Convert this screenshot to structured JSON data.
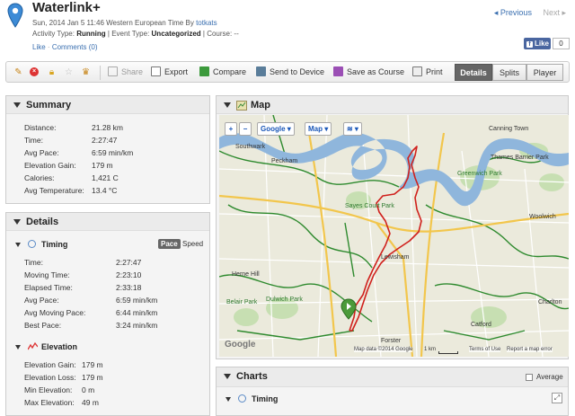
{
  "header": {
    "title": "Waterlink+",
    "date_prefix": "Sun, 2014 Jan 5 11:46 Western European Time By",
    "user": "totkats",
    "activity_type_label": "Activity Type:",
    "activity_type": "Running",
    "event_type_label": "| Event Type:",
    "event_type": "Uncategorized",
    "course_text": "| Course: --",
    "like_link": "Like",
    "comments_link": "Comments (0)",
    "sep": "·",
    "prev": "◂ Previous",
    "next": "Next ▸",
    "fb_like": "Like",
    "fb_count": "0"
  },
  "toolbar": {
    "share": "Share",
    "export": "Export",
    "compare": "Compare",
    "send": "Send to Device",
    "save_course": "Save as Course",
    "print": "Print",
    "tabs": [
      "Details",
      "Splits",
      "Player"
    ]
  },
  "summary": {
    "title": "Summary",
    "rows": [
      {
        "label": "Distance:",
        "value": "21.28 km"
      },
      {
        "label": "Time:",
        "value": "2:27:47"
      },
      {
        "label": "Avg Pace:",
        "value": "6:59 min/km"
      },
      {
        "label": "Elevation Gain:",
        "value": "179 m"
      },
      {
        "label": "Calories:",
        "value": "1,421 C"
      },
      {
        "label": "Avg Temperature:",
        "value": "13.4 °C"
      }
    ]
  },
  "details": {
    "title": "Details",
    "timing_title": "Timing",
    "pace_btn": "Pace",
    "speed_btn": "Speed",
    "timing_rows": [
      {
        "label": "Time:",
        "value": "2:27:47"
      },
      {
        "label": "Moving Time:",
        "value": "2:23:10"
      },
      {
        "label": "Elapsed Time:",
        "value": "2:33:18"
      },
      {
        "label": "Avg Pace:",
        "value": "6:59 min/km"
      },
      {
        "label": "Avg Moving Pace:",
        "value": "6:44 min/km"
      },
      {
        "label": "Best Pace:",
        "value": "3:24 min/km"
      }
    ],
    "elevation_title": "Elevation",
    "elevation_rows": [
      {
        "label": "Elevation Gain:",
        "value": "179 m"
      },
      {
        "label": "Elevation Loss:",
        "value": "179 m"
      },
      {
        "label": "Min Elevation:",
        "value": "0 m"
      },
      {
        "label": "Max Elevation:",
        "value": "49 m"
      }
    ]
  },
  "map_panel": {
    "title": "Map",
    "zoom_in": "+",
    "zoom_out": "−",
    "provider": "Google ▾",
    "type": "Map ▾",
    "layers": "≋ ▾",
    "labels": {
      "southwark": "Southwark",
      "peckham": "Peckham",
      "lewisham": "Lewisham",
      "dulwich": "Dulwich Park",
      "belair": "Belair Park",
      "hernehill": "Herne Hill",
      "greenwich": "Greenwich Park",
      "charlton": "Charlton",
      "sayes": "Sayes Court Park",
      "canning": "Canning Town",
      "thames": "Thames Barrier Park",
      "woolwich": "Woolwich",
      "forster": "Forster",
      "catford": "Catford"
    },
    "scale": "1 km",
    "data_credit": "Map data ©2014 Google",
    "terms": "Terms of Use",
    "report": "Report a map error",
    "logo": "Google"
  },
  "charts_panel": {
    "title": "Charts",
    "average_label": "Average",
    "timing_title": "Timing"
  },
  "colors": {
    "accent": "#3a6fb0",
    "route": "#d0201c",
    "water": "#8fb6dc",
    "park": "#c7dfb2"
  }
}
